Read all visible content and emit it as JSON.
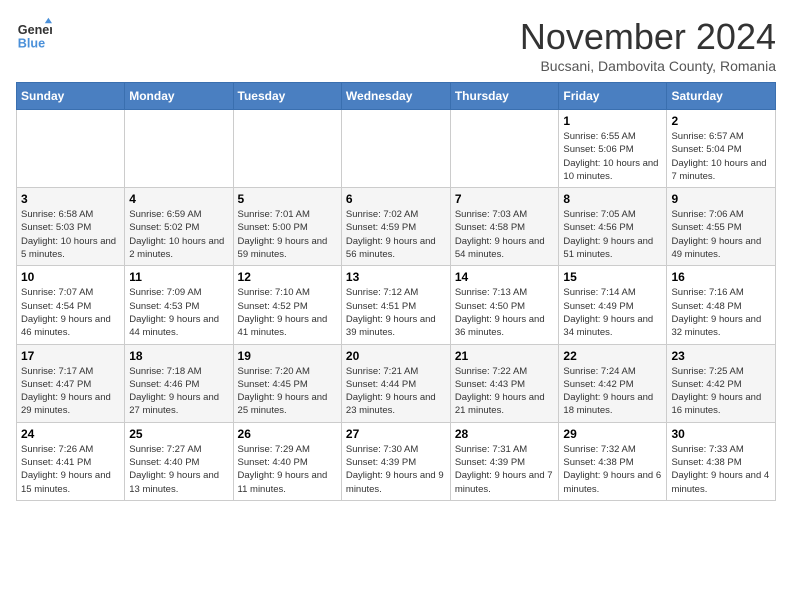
{
  "logo": {
    "line1": "General",
    "line2": "Blue"
  },
  "title": "November 2024",
  "subtitle": "Bucsani, Dambovita County, Romania",
  "weekdays": [
    "Sunday",
    "Monday",
    "Tuesday",
    "Wednesday",
    "Thursday",
    "Friday",
    "Saturday"
  ],
  "weeks": [
    [
      {
        "day": "",
        "info": ""
      },
      {
        "day": "",
        "info": ""
      },
      {
        "day": "",
        "info": ""
      },
      {
        "day": "",
        "info": ""
      },
      {
        "day": "",
        "info": ""
      },
      {
        "day": "1",
        "info": "Sunrise: 6:55 AM\nSunset: 5:06 PM\nDaylight: 10 hours and 10 minutes."
      },
      {
        "day": "2",
        "info": "Sunrise: 6:57 AM\nSunset: 5:04 PM\nDaylight: 10 hours and 7 minutes."
      }
    ],
    [
      {
        "day": "3",
        "info": "Sunrise: 6:58 AM\nSunset: 5:03 PM\nDaylight: 10 hours and 5 minutes."
      },
      {
        "day": "4",
        "info": "Sunrise: 6:59 AM\nSunset: 5:02 PM\nDaylight: 10 hours and 2 minutes."
      },
      {
        "day": "5",
        "info": "Sunrise: 7:01 AM\nSunset: 5:00 PM\nDaylight: 9 hours and 59 minutes."
      },
      {
        "day": "6",
        "info": "Sunrise: 7:02 AM\nSunset: 4:59 PM\nDaylight: 9 hours and 56 minutes."
      },
      {
        "day": "7",
        "info": "Sunrise: 7:03 AM\nSunset: 4:58 PM\nDaylight: 9 hours and 54 minutes."
      },
      {
        "day": "8",
        "info": "Sunrise: 7:05 AM\nSunset: 4:56 PM\nDaylight: 9 hours and 51 minutes."
      },
      {
        "day": "9",
        "info": "Sunrise: 7:06 AM\nSunset: 4:55 PM\nDaylight: 9 hours and 49 minutes."
      }
    ],
    [
      {
        "day": "10",
        "info": "Sunrise: 7:07 AM\nSunset: 4:54 PM\nDaylight: 9 hours and 46 minutes."
      },
      {
        "day": "11",
        "info": "Sunrise: 7:09 AM\nSunset: 4:53 PM\nDaylight: 9 hours and 44 minutes."
      },
      {
        "day": "12",
        "info": "Sunrise: 7:10 AM\nSunset: 4:52 PM\nDaylight: 9 hours and 41 minutes."
      },
      {
        "day": "13",
        "info": "Sunrise: 7:12 AM\nSunset: 4:51 PM\nDaylight: 9 hours and 39 minutes."
      },
      {
        "day": "14",
        "info": "Sunrise: 7:13 AM\nSunset: 4:50 PM\nDaylight: 9 hours and 36 minutes."
      },
      {
        "day": "15",
        "info": "Sunrise: 7:14 AM\nSunset: 4:49 PM\nDaylight: 9 hours and 34 minutes."
      },
      {
        "day": "16",
        "info": "Sunrise: 7:16 AM\nSunset: 4:48 PM\nDaylight: 9 hours and 32 minutes."
      }
    ],
    [
      {
        "day": "17",
        "info": "Sunrise: 7:17 AM\nSunset: 4:47 PM\nDaylight: 9 hours and 29 minutes."
      },
      {
        "day": "18",
        "info": "Sunrise: 7:18 AM\nSunset: 4:46 PM\nDaylight: 9 hours and 27 minutes."
      },
      {
        "day": "19",
        "info": "Sunrise: 7:20 AM\nSunset: 4:45 PM\nDaylight: 9 hours and 25 minutes."
      },
      {
        "day": "20",
        "info": "Sunrise: 7:21 AM\nSunset: 4:44 PM\nDaylight: 9 hours and 23 minutes."
      },
      {
        "day": "21",
        "info": "Sunrise: 7:22 AM\nSunset: 4:43 PM\nDaylight: 9 hours and 21 minutes."
      },
      {
        "day": "22",
        "info": "Sunrise: 7:24 AM\nSunset: 4:42 PM\nDaylight: 9 hours and 18 minutes."
      },
      {
        "day": "23",
        "info": "Sunrise: 7:25 AM\nSunset: 4:42 PM\nDaylight: 9 hours and 16 minutes."
      }
    ],
    [
      {
        "day": "24",
        "info": "Sunrise: 7:26 AM\nSunset: 4:41 PM\nDaylight: 9 hours and 15 minutes."
      },
      {
        "day": "25",
        "info": "Sunrise: 7:27 AM\nSunset: 4:40 PM\nDaylight: 9 hours and 13 minutes."
      },
      {
        "day": "26",
        "info": "Sunrise: 7:29 AM\nSunset: 4:40 PM\nDaylight: 9 hours and 11 minutes."
      },
      {
        "day": "27",
        "info": "Sunrise: 7:30 AM\nSunset: 4:39 PM\nDaylight: 9 hours and 9 minutes."
      },
      {
        "day": "28",
        "info": "Sunrise: 7:31 AM\nSunset: 4:39 PM\nDaylight: 9 hours and 7 minutes."
      },
      {
        "day": "29",
        "info": "Sunrise: 7:32 AM\nSunset: 4:38 PM\nDaylight: 9 hours and 6 minutes."
      },
      {
        "day": "30",
        "info": "Sunrise: 7:33 AM\nSunset: 4:38 PM\nDaylight: 9 hours and 4 minutes."
      }
    ]
  ]
}
